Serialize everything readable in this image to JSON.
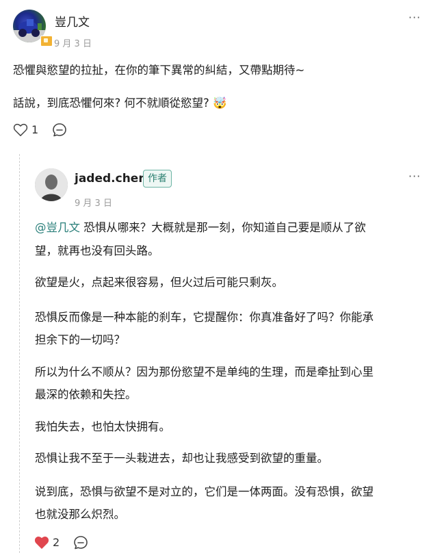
{
  "comment": {
    "author": "豈几文",
    "date": "9 月 3 日",
    "more": "···",
    "paragraphs": [
      "恐懼與慾望的拉扯，在你的筆下異常的糾結，又帶點期待~",
      "話說，到底恐懼何來? 何不就順從慾望? "
    ],
    "emoji": "🤯",
    "likes": "1"
  },
  "reply": {
    "author": "jaded.chen",
    "author_badge": "作者",
    "date": "9 月 3 日",
    "more": "···",
    "mention": "@豈几文",
    "paragraphs": [
      " 恐惧从哪来？大概就是那一刻，你知道自己要是顺从了欲",
      "望，就再也没有回头路。",
      "欲望是火，点起来很容易，但火过后可能只剩灰。",
      "恐惧反而像是一种本能的刹车，它提醒你：你真准备好了吗？你能承",
      "担余下的一切吗？",
      "所以为什么不顺从？因为那份慾望不是单纯的生理，而是牵扯到心里",
      "最深的依赖和失控。",
      "我怕失去，也怕太快拥有。",
      "恐惧让我不至于一头栽进去，却也让我感受到欲望的重量。",
      "说到底，恐惧与欲望不是对立的，它们是一体两面。没有恐惧，欲望",
      "也就没那么炽烈。"
    ],
    "likes": "2",
    "liked": true
  },
  "colors": {
    "accent": "#2a7f7a",
    "like_red": "#e0464e",
    "muted": "#9b9b9b"
  },
  "icons": [
    "heart-icon",
    "comment-icon",
    "more-icon",
    "verified-badge-icon"
  ]
}
